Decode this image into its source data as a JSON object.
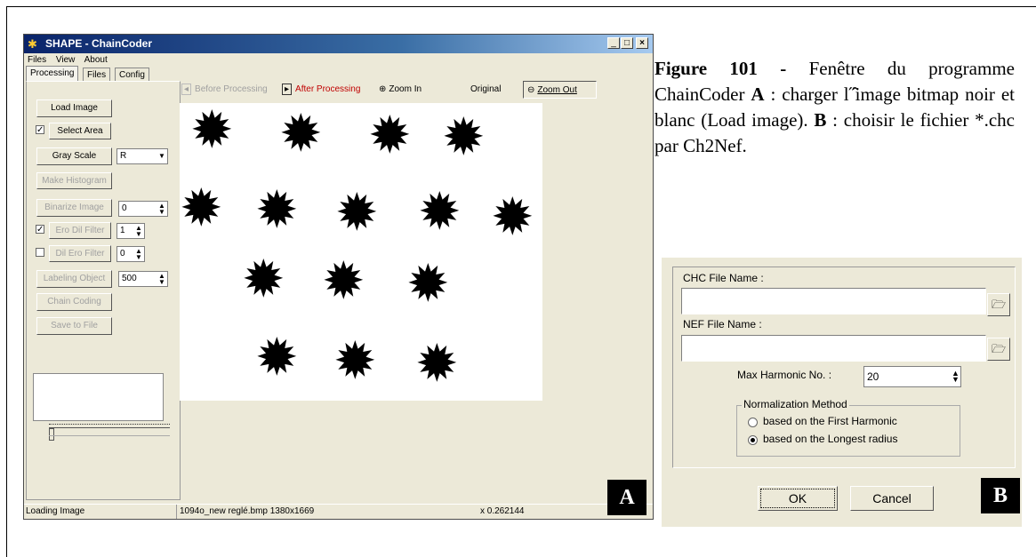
{
  "window": {
    "title": "SHAPE - ChainCoder",
    "caption_buttons": [
      "_",
      "□",
      "×"
    ],
    "menu": [
      "Files",
      "View",
      "About"
    ],
    "tabs": [
      "Processing",
      "Files",
      "Config"
    ],
    "buttons": {
      "load_image": "Load Image",
      "select_area": "Select Area",
      "gray_scale": "Gray Scale",
      "make_histogram": "Make Histogram",
      "binarize_image": "Binarize Image",
      "ero_dil_filter": "Ero Dil Filter",
      "dil_ero_filter": "Dil Ero Filter",
      "labeling_object": "Labeling Object",
      "chain_coding": "Chain Coding",
      "save_to_file": "Save to File"
    },
    "values": {
      "gray_channel": "R",
      "binarize": "0",
      "ero_dil": "1",
      "dil_ero": "0",
      "labeling": "500"
    },
    "checks": {
      "select_area": true,
      "ero_dil": true,
      "dil_ero": false
    },
    "toolbar": {
      "before": "Before Processing",
      "after": "After Processing",
      "zoom_in": "Zoom In",
      "original": "Original",
      "zoom_out": "Zoom Out"
    },
    "status": {
      "left": "Loading Image",
      "file": "1094o_new reglé.bmp 1380x1669",
      "zoom": "x 0.262144"
    },
    "label": "A"
  },
  "caption": {
    "lead": "Figure 101 -",
    "text": " Fenêtre du programme ChainCoder ",
    "a": "A",
    "text2": " : charger l˝̂image bitmap noir et blanc (Load image). ",
    "b": "B",
    "text3": " : choisir le fichier *.chc par Ch2Nef."
  },
  "dialog": {
    "chc_label": "CHC File Name :",
    "nef_label": "NEF File Name :",
    "max_harmonic_label": "Max Harmonic No. :",
    "max_harmonic_value": "20",
    "group_label": "Normalization Method",
    "radio1": "based on the First Harmonic",
    "radio2": "based on the Longest radius",
    "ok": "OK",
    "cancel": "Cancel",
    "label": "B"
  }
}
